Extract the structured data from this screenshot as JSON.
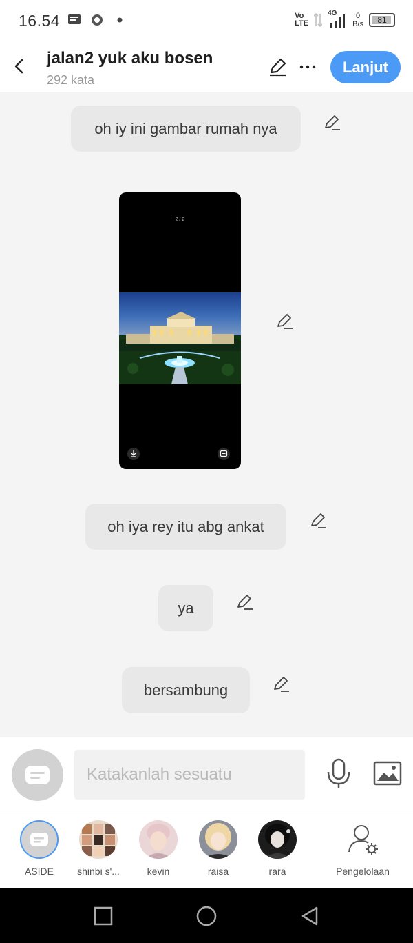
{
  "status": {
    "time": "16.54",
    "network_top": "Vo",
    "network_bottom": "LTE",
    "signal_type": "4G",
    "speed_value": "0",
    "speed_unit": "B/s",
    "battery": "81",
    "icons": [
      "message-icon",
      "whatsapp-icon",
      "dot-icon",
      "volte-icon",
      "data-arrows-icon",
      "signal-icon",
      "battery-icon"
    ]
  },
  "header": {
    "title": "jalan2 yuk aku bosen",
    "word_count": "292 kata",
    "continue_label": "Lanjut",
    "accent": "#4b9af5"
  },
  "messages": [
    {
      "text": "oh iy ini gambar rumah nya"
    },
    {
      "image": "mansion-photo",
      "counter": "2 / 2"
    },
    {
      "text": "oh iya rey itu abg ankat"
    },
    {
      "text": "ya"
    },
    {
      "text": "bersambung"
    }
  ],
  "input": {
    "placeholder": "Katakanlah sesuatu"
  },
  "characters": [
    {
      "name": "ASIDE"
    },
    {
      "name": "shinbi s'..."
    },
    {
      "name": "kevin"
    },
    {
      "name": "raisa"
    },
    {
      "name": "rara"
    },
    {
      "name": "Pengelolaan"
    }
  ]
}
